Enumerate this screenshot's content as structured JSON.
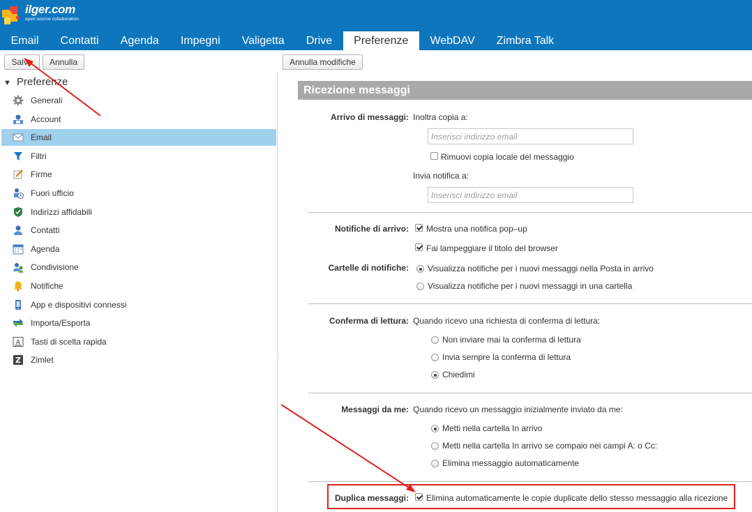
{
  "brand": {
    "name": "ilger.com",
    "tagline": "open source collaboration"
  },
  "tabs": [
    "Email",
    "Contatti",
    "Agenda",
    "Impegni",
    "Valigetta",
    "Drive",
    "Preferenze",
    "WebDAV",
    "Zimbra Talk"
  ],
  "active_tab": "Preferenze",
  "toolbar": {
    "save": "Salva",
    "cancel": "Annulla",
    "undo_changes": "Annulla modifiche"
  },
  "sidebar": {
    "header": "Preferenze",
    "items": [
      {
        "label": "Generali",
        "icon": "gear-icon"
      },
      {
        "label": "Account",
        "icon": "account-icon"
      },
      {
        "label": "Email",
        "icon": "envelope-icon",
        "selected": true
      },
      {
        "label": "Filtri",
        "icon": "filter-icon"
      },
      {
        "label": "Firme",
        "icon": "signature-icon"
      },
      {
        "label": "Fuori ufficio",
        "icon": "out-of-office-icon"
      },
      {
        "label": "Indirizzi affidabili",
        "icon": "shield-icon"
      },
      {
        "label": "Contatti",
        "icon": "contact-icon"
      },
      {
        "label": "Agenda",
        "icon": "calendar-icon"
      },
      {
        "label": "Condivisione",
        "icon": "sharing-icon"
      },
      {
        "label": "Notifiche",
        "icon": "bell-icon"
      },
      {
        "label": "App e dispositivi connessi",
        "icon": "device-icon"
      },
      {
        "label": "Importa/Esporta",
        "icon": "import-export-icon"
      },
      {
        "label": "Tasti di scelta rapida",
        "icon": "keyboard-icon"
      },
      {
        "label": "Zimlet",
        "icon": "zimlet-icon"
      }
    ]
  },
  "main": {
    "section_title": "Ricezione messaggi",
    "arrivo": {
      "label": "Arrivo di messaggi:",
      "forward_label": "Inoltra copia a:",
      "forward_placeholder": "Inserisci indirizzo email",
      "remove_local": "Rimuovi copia locale del messaggio",
      "remove_local_checked": false,
      "notify_label": "Invia notifica a:",
      "notify_placeholder": "Inserisci indirizzo email"
    },
    "notifiche": {
      "label": "Notifiche di arrivo:",
      "popup": "Mostra una notifica pop–up",
      "popup_checked": true,
      "flash": "Fai lampeggiare il titolo del browser",
      "flash_checked": true
    },
    "cartelle": {
      "label": "Cartelle di notifiche:",
      "options": [
        "Visualizza notifiche per i nuovi messaggi nella Posta in arrivo",
        "Visualizza notifiche per i nuovi messaggi in una cartella"
      ],
      "selected": 0
    },
    "conferma": {
      "label": "Conferma di lettura:",
      "intro": "Quando ricevo una richiesta di conferma di lettura:",
      "options": [
        "Non inviare mai la conferma di lettura",
        "Invia sempre la conferma di lettura",
        "Chiedimi"
      ],
      "selected": 2
    },
    "da_me": {
      "label": "Messaggi da me:",
      "intro": "Quando ricevo un messaggio inizialmente inviato da me:",
      "options": [
        "Metti nella cartella In arrivo",
        "Metti nella cartella In arrivo se compaio nei campi A: o Cc:",
        "Elimina messaggio automaticamente"
      ],
      "selected": 0
    },
    "duplica": {
      "label": "Duplica messaggi:",
      "option": "Elimina automaticamente le copie duplicate dello stesso messaggio alla ricezione",
      "checked": true
    }
  },
  "colors": {
    "header": "#0d76bd",
    "selected_nav": "#9fd0ec",
    "section_title_bg": "#a9a9a9",
    "annotation": "#e02020"
  }
}
